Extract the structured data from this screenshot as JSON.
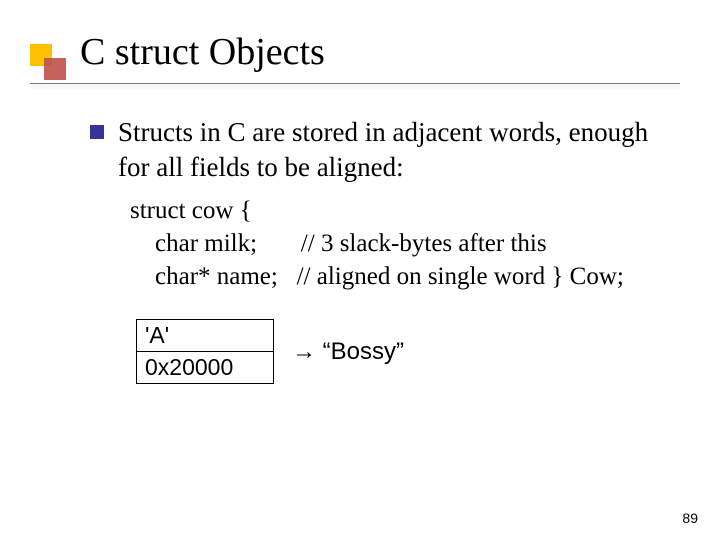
{
  "title": "C struct Objects",
  "bullet": "Structs in C are stored in adjacent words, enough for all fields to be aligned:",
  "code": {
    "l1": "struct cow {",
    "l2": "    char milk;       // 3 slack-bytes after this",
    "l3": "    char* name;   // aligned on single word } Cow;"
  },
  "memory": {
    "cell1": "'A'",
    "cell2": "0x20000",
    "label": "→  “Bossy”"
  },
  "page_number": "89"
}
